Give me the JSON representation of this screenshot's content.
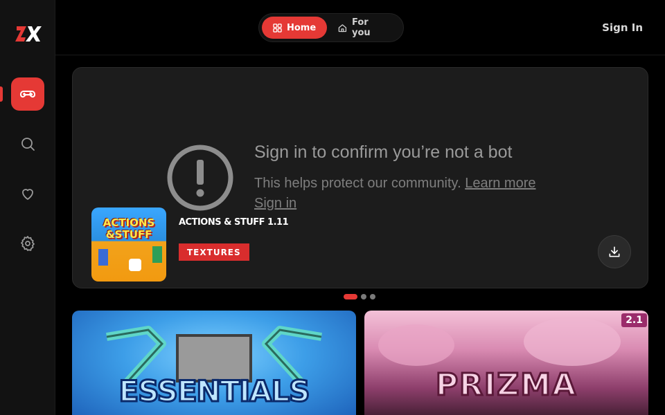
{
  "app": {
    "logo_text": "ZX"
  },
  "sidebar": {
    "items": [
      {
        "name": "gamepad-icon",
        "active": true
      },
      {
        "name": "search-icon",
        "active": false
      },
      {
        "name": "heart-icon",
        "active": false
      },
      {
        "name": "gear-icon",
        "active": false
      }
    ]
  },
  "header": {
    "tabs": [
      {
        "label": "Home",
        "icon": "grid-icon",
        "active": true
      },
      {
        "label": "For you",
        "icon": "home-icon",
        "active": false
      }
    ],
    "sign_in_label": "Sign In"
  },
  "hero": {
    "overlay": {
      "title": "Sign in to confirm you’re not a bot",
      "text": "This helps protect our community.",
      "learn_more": "Learn more",
      "sign_in": "Sign in"
    },
    "item_title": "ACTIONS & STUFF 1.11",
    "thumb_text_line1": "ACTIONS",
    "thumb_text_line2": "&STUFF",
    "badge": "TEXTURES",
    "download_icon": "download-icon"
  },
  "carousel": {
    "count": 3,
    "active_index": 0
  },
  "cards": [
    {
      "title": "ESSENTIALS"
    },
    {
      "title": "PRIZMA",
      "version": "2.1"
    }
  ],
  "colors": {
    "accent": "#e53935",
    "background": "#000000",
    "sidebar": "#121212",
    "panel": "#1c1c1c"
  }
}
